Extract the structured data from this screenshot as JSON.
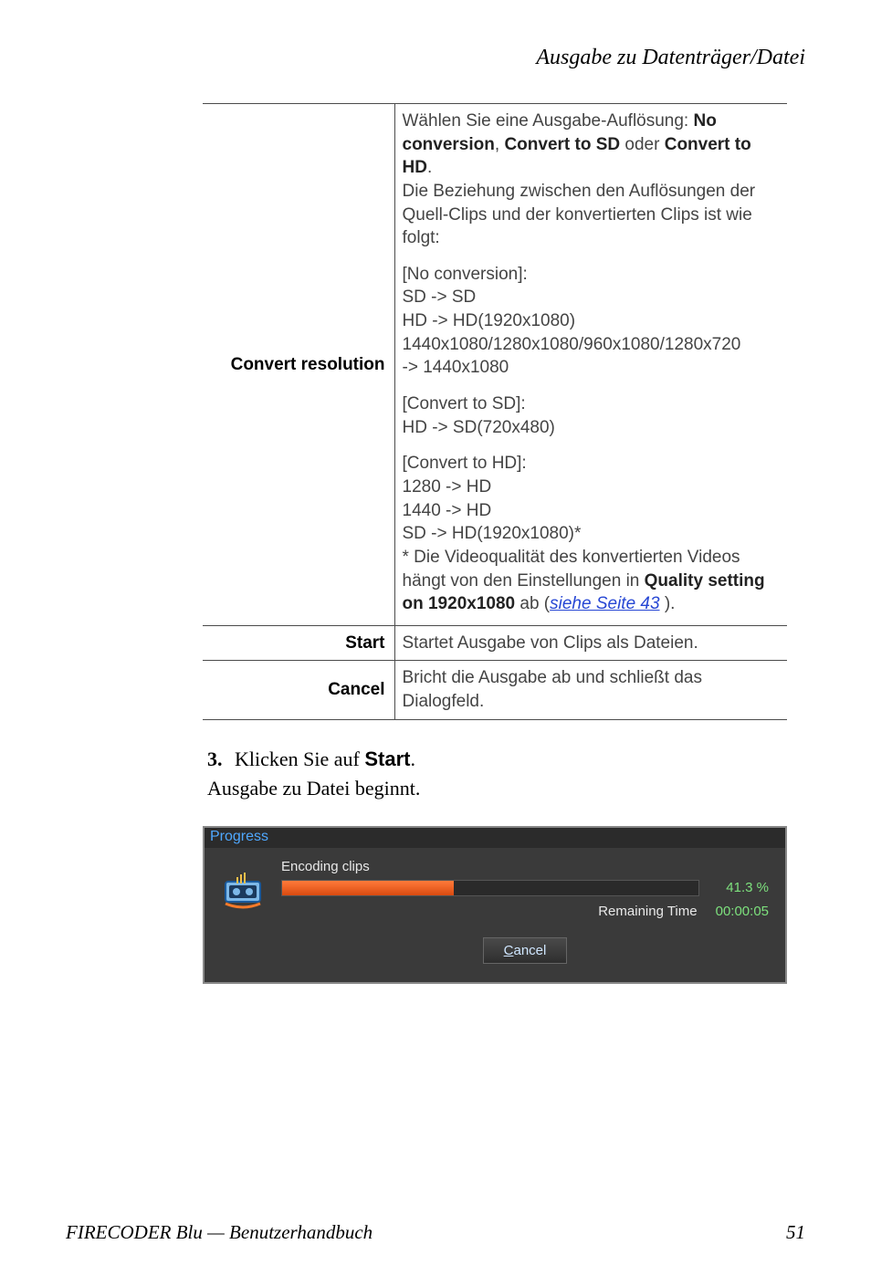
{
  "header": {
    "title": "Ausgabe zu Datenträger/Datei"
  },
  "table": {
    "rows": [
      {
        "label": "Convert resolution",
        "intro": {
          "pre": "Wählen Sie eine Ausgabe-Auflösung: ",
          "b1": "No conversion",
          "mid1": ", ",
          "b2": "Convert to SD",
          "mid2": " oder ",
          "b3": "Convert to HD",
          "post": ".",
          "line2": "Die Beziehung zwischen den Auflösungen der Quell-Clips und der konvertierten Clips ist wie folgt:"
        },
        "blocks": [
          {
            "lines": [
              "[No conversion]:",
              "SD -> SD",
              "HD -> HD(1920x1080)",
              "1440x1080/1280x1080/960x1080/1280x720",
              "-> 1440x1080"
            ]
          },
          {
            "lines": [
              "[Convert to SD]:",
              "HD -> SD(720x480)"
            ]
          },
          {
            "lines": [
              "[Convert to HD]:",
              "1280 -> HD",
              "1440 -> HD",
              "SD -> HD(1920x1080)*"
            ],
            "footnote": {
              "pre": "* Die Videoqualität des konvertierten Videos hängt von den Einstellungen in ",
              "b1": "Quality setting on 1920x1080",
              "mid": " ab (",
              "link": "siehe Seite 43",
              "post": " )."
            }
          }
        ]
      },
      {
        "label": "Start",
        "text": "Startet Ausgabe von Clips als Dateien."
      },
      {
        "label": "Cancel",
        "text": "Bricht die Ausgabe ab und schließt das Dialogfeld."
      }
    ]
  },
  "step": {
    "num": "3.",
    "pre": "Klicken Sie auf ",
    "bold": "Start",
    "post": "."
  },
  "aftertext": "Ausgabe zu Datei beginnt.",
  "dialog": {
    "title": "Progress",
    "encoding_label": "Encoding clips",
    "percent": "41.3 %",
    "remaining_label": "Remaining Time",
    "remaining_value": "00:00:05",
    "cancel_first": "C",
    "cancel_rest": "ancel"
  },
  "footer": {
    "left": "FIRECODER Blu  —  Benutzerhandbuch",
    "right": "51"
  }
}
